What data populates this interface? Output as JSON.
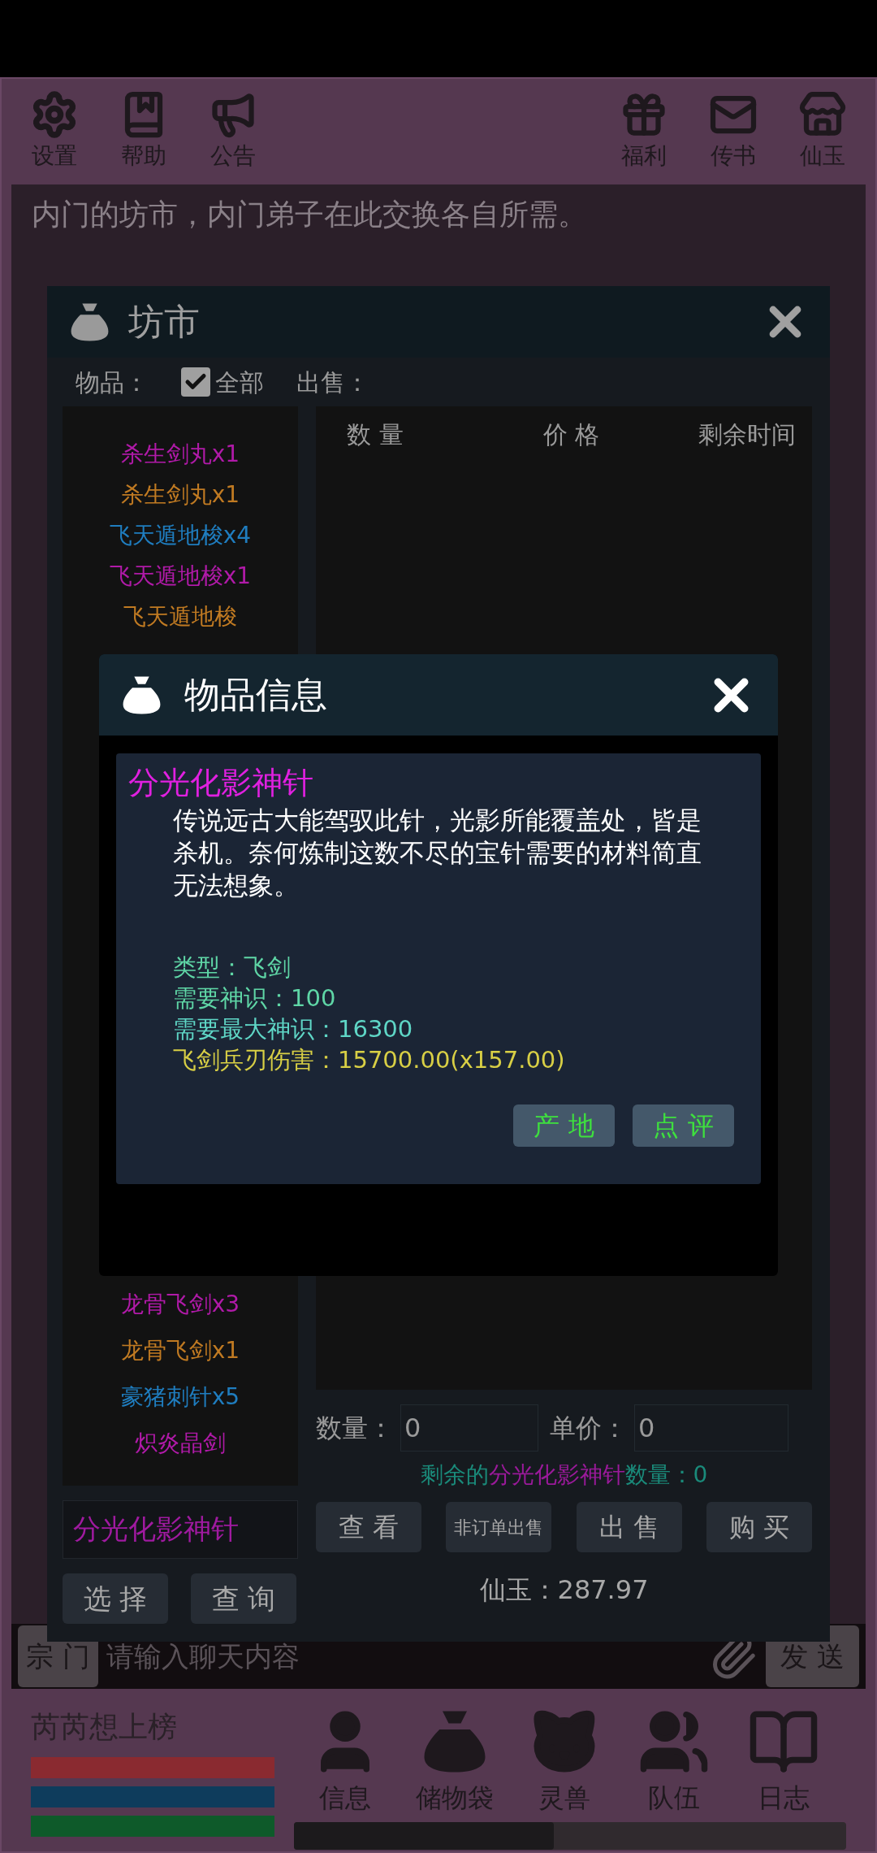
{
  "toolbar_left": [
    {
      "label": "设置",
      "kind": "gear"
    },
    {
      "label": "帮助",
      "kind": "book"
    },
    {
      "label": "公告",
      "kind": "megaphone"
    }
  ],
  "toolbar_right": [
    {
      "label": "福利",
      "kind": "gift"
    },
    {
      "label": "传书",
      "kind": "mail"
    },
    {
      "label": "仙玉",
      "kind": "store"
    }
  ],
  "description": "内门的坊市，内门弟子在此交换各自所需。",
  "market": {
    "title": "坊市",
    "filter_label": "物品：",
    "all": {
      "label": "全部",
      "checked": true
    },
    "sell_label": "出售：",
    "columns": [
      "数 量",
      "价 格",
      "剩余时间"
    ],
    "items_top": [
      {
        "name": "杀生剑丸x1",
        "color": "#b01aa8"
      },
      {
        "name": "杀生剑丸x1",
        "color": "#c07a22"
      },
      {
        "name": "飞天遁地梭x4",
        "color": "#1f7dbf"
      },
      {
        "name": "飞天遁地梭x1",
        "color": "#b01aa8"
      },
      {
        "name": "飞天遁地梭",
        "color": "#c07a22"
      }
    ],
    "items_bottom": [
      {
        "name": "龙骨飞剑x3",
        "color": "#b01aa8"
      },
      {
        "name": "龙骨飞剑x1",
        "color": "#c07a22"
      },
      {
        "name": "豪猪刺针x5",
        "color": "#1f7dbf"
      },
      {
        "name": "炽炎晶剑",
        "color": "#b01aa8"
      }
    ],
    "search_value": "分光化影神针",
    "buttons_left": [
      "选 择",
      "查 询"
    ],
    "quantity": {
      "label": "数量：",
      "value": "0"
    },
    "price": {
      "label": "单价：",
      "value": "0"
    },
    "remaining": {
      "prefix": "剩余的",
      "item": "分光化影神针",
      "suffix": "数量：0"
    },
    "actions": [
      "查 看",
      "非订单出售",
      "出 售",
      "购 买"
    ],
    "balance": "仙玉：287.97"
  },
  "item_info": {
    "title": "物品信息",
    "name": "分光化影神针",
    "description": "传说远古大能驾驭此针，光影所能覆盖处，皆是杀机。奈何炼制这数不尽的宝针需要的材料简直无法想象。",
    "stats": [
      {
        "text": "类型：飞剑",
        "color": "#5fd6a6"
      },
      {
        "text": "需要神识：100",
        "color": "#5fd6a6"
      },
      {
        "text": "需要最大神识：16300",
        "color": "#5fd6c6"
      },
      {
        "text": "飞剑兵刃伤害：15700.00(x157.00)",
        "color": "#d8cf45"
      }
    ],
    "buttons": [
      "产 地",
      "点 评"
    ]
  },
  "chat": {
    "channel": "宗 门",
    "placeholder": "请输入聊天内容",
    "send": "发 送"
  },
  "player": {
    "name": "芮芮想上榜",
    "bars": [
      {
        "level": 1,
        "color": "#8a2a30"
      },
      {
        "level": 1,
        "color": "#0e3c5c"
      },
      {
        "level": 1,
        "color": "#0e5a2a"
      }
    ]
  },
  "nav": [
    {
      "label": "信息",
      "kind": "user"
    },
    {
      "label": "储物袋",
      "kind": "bag"
    },
    {
      "label": "灵兽",
      "kind": "cat"
    },
    {
      "label": "队伍",
      "kind": "users"
    },
    {
      "label": "日志",
      "kind": "book"
    }
  ]
}
